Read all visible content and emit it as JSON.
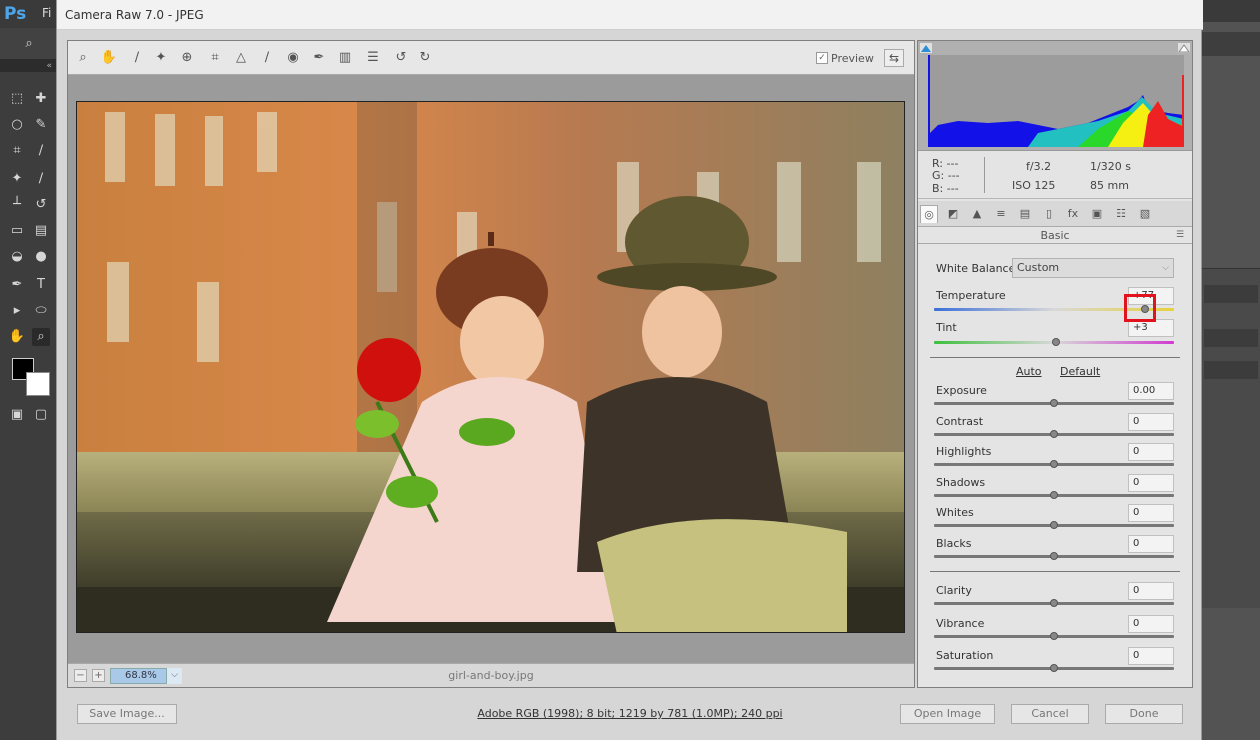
{
  "app": {
    "dialog_title": "Camera Raw 7.0  -  JPEG",
    "ps_logo": "Ps",
    "ps_menu_stub": "Fi"
  },
  "preview": {
    "checkbox_label": "Preview",
    "checked": true,
    "zoom_level": "68.8%",
    "zoom_minus": "−",
    "zoom_plus": "+",
    "filename": "girl-and-boy.jpg"
  },
  "toolstrip_icons": [
    "zoom-tool-icon",
    "hand-tool-icon",
    "white-balance-tool-icon",
    "color-sampler-tool-icon",
    "targeted-adjustment-tool-icon",
    "crop-tool-icon",
    "straighten-tool-icon",
    "spot-removal-tool-icon",
    "red-eye-removal-tool-icon",
    "adjustment-brush-icon",
    "graduated-filter-icon",
    "preferences-icon",
    "rotate-left-icon",
    "rotate-right-icon"
  ],
  "readout": {
    "r_label": "R:",
    "r_value": "---",
    "g_label": "G:",
    "g_value": "---",
    "b_label": "B:",
    "b_value": "---",
    "aperture": "f/3.2",
    "shutter": "1/320 s",
    "iso": "ISO 125",
    "focal_length": "85 mm"
  },
  "panel_tabs": [
    "basic-tab-icon",
    "tone-curve-tab-icon",
    "detail-tab-icon",
    "hsl-tab-icon",
    "split-toning-tab-icon",
    "lens-corrections-tab-icon",
    "effects-tab-icon",
    "camera-calibration-tab-icon",
    "presets-tab-icon",
    "snapshots-tab-icon"
  ],
  "basic": {
    "title": "Basic",
    "white_balance_label": "White Balance:",
    "white_balance_value": "Custom",
    "temperature": {
      "label": "Temperature",
      "value": "+77",
      "level": 0.88
    },
    "tint": {
      "label": "Tint",
      "value": "+3",
      "level": 0.51
    },
    "auto_label": "Auto",
    "default_label": "Default",
    "sliders": [
      {
        "label": "Exposure",
        "value": "0.00",
        "level": 0.5
      },
      {
        "label": "Contrast",
        "value": "0",
        "level": 0.5
      },
      {
        "label": "Highlights",
        "value": "0",
        "level": 0.5
      },
      {
        "label": "Shadows",
        "value": "0",
        "level": 0.5
      },
      {
        "label": "Whites",
        "value": "0",
        "level": 0.5
      },
      {
        "label": "Blacks",
        "value": "0",
        "level": 0.5
      }
    ],
    "presence": [
      {
        "label": "Clarity",
        "value": "0",
        "level": 0.5
      },
      {
        "label": "Vibrance",
        "value": "0",
        "level": 0.5
      },
      {
        "label": "Saturation",
        "value": "0",
        "level": 0.5
      }
    ]
  },
  "footer": {
    "save_image": "Save Image...",
    "workflow_options": "Adobe RGB (1998); 8 bit; 1219 by 781 (1.0MP); 240 ppi",
    "open_image": "Open Image",
    "cancel": "Cancel",
    "done": "Done"
  },
  "colors": {
    "highlight": "#e1141d",
    "zoom_field": "#a9c9e8"
  }
}
